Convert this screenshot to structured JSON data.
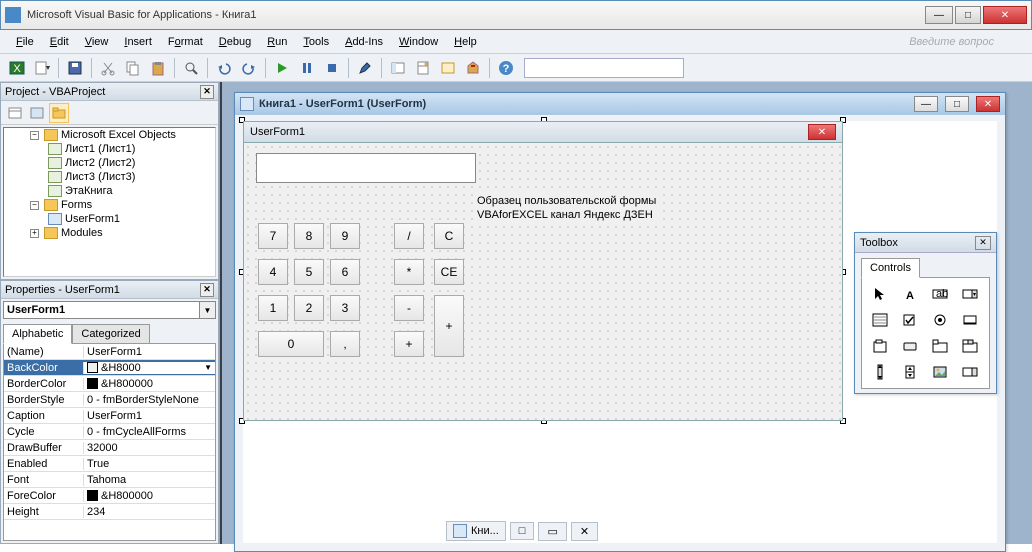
{
  "window": {
    "title": "Microsoft Visual Basic for Applications - Книга1"
  },
  "menu": {
    "file": "File",
    "edit": "Edit",
    "view": "View",
    "insert": "Insert",
    "format": "Format",
    "debug": "Debug",
    "run": "Run",
    "tools": "Tools",
    "addins": "Add-Ins",
    "window": "Window",
    "help": "Help",
    "search_hint": "Введите вопрос"
  },
  "project_panel": {
    "title": "Project - VBAProject",
    "items": {
      "excel_objects": "Microsoft Excel Objects",
      "sheet1": "Лист1 (Лист1)",
      "sheet2": "Лист2 (Лист2)",
      "sheet3": "Лист3 (Лист3)",
      "workbook": "ЭтаКнига",
      "forms": "Forms",
      "userform1": "UserForm1",
      "modules": "Modules"
    }
  },
  "properties_panel": {
    "title": "Properties - UserForm1",
    "object": "UserForm1",
    "object_type": "UserForm",
    "tab_alpha": "Alphabetic",
    "tab_cat": "Categorized",
    "rows": [
      {
        "name": "(Name)",
        "value": "UserForm1"
      },
      {
        "name": "BackColor",
        "value": "&H8000",
        "color": "#f0f0f0",
        "selected": true,
        "dd": true
      },
      {
        "name": "BorderColor",
        "value": "&H800000",
        "color": "#000000"
      },
      {
        "name": "BorderStyle",
        "value": "0 - fmBorderStyleNone"
      },
      {
        "name": "Caption",
        "value": "UserForm1"
      },
      {
        "name": "Cycle",
        "value": "0 - fmCycleAllForms"
      },
      {
        "name": "DrawBuffer",
        "value": "32000"
      },
      {
        "name": "Enabled",
        "value": "True"
      },
      {
        "name": "Font",
        "value": "Tahoma"
      },
      {
        "name": "ForeColor",
        "value": "&H800000",
        "color": "#000000"
      },
      {
        "name": "Height",
        "value": "234"
      }
    ]
  },
  "form_window": {
    "title": "Книга1 - UserForm1 (UserForm)"
  },
  "userform": {
    "caption": "UserForm1",
    "label_line1": "Образец пользовательской формы",
    "label_line2": "VBAforEXCEL канал Яндекс ДЗЕН",
    "buttons": {
      "b7": "7",
      "b8": "8",
      "b9": "9",
      "bdiv": "/",
      "bc": "C",
      "b4": "4",
      "b5": "5",
      "b6": "6",
      "bmul": "*",
      "bce": "CE",
      "b1": "1",
      "b2": "2",
      "b3": "3",
      "bsub": "-",
      "bplus": "+",
      "b0": "0",
      "bcomma": ",",
      "badd": "+"
    }
  },
  "toolbox": {
    "title": "Toolbox",
    "tab": "Controls"
  },
  "taskbar": {
    "item": "Кни..."
  }
}
